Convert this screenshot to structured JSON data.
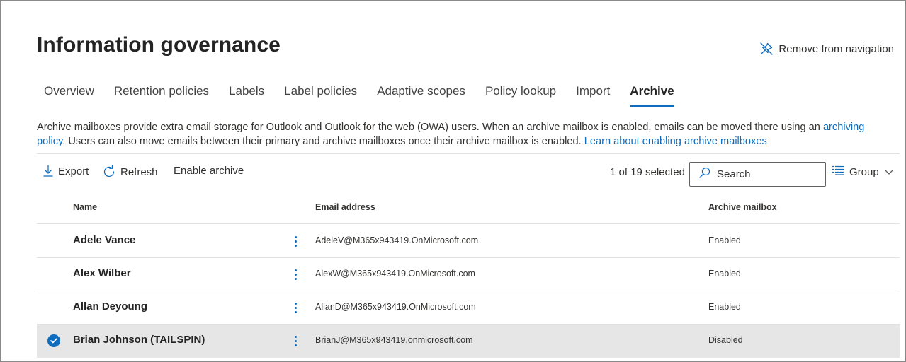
{
  "page": {
    "title": "Information governance",
    "remove_nav_label": "Remove from navigation"
  },
  "tabs": [
    {
      "label": "Overview",
      "active": false
    },
    {
      "label": "Retention policies",
      "active": false
    },
    {
      "label": "Labels",
      "active": false
    },
    {
      "label": "Label policies",
      "active": false
    },
    {
      "label": "Adaptive scopes",
      "active": false
    },
    {
      "label": "Policy lookup",
      "active": false
    },
    {
      "label": "Import",
      "active": false
    },
    {
      "label": "Archive",
      "active": true
    }
  ],
  "description": {
    "text1": "Archive mailboxes provide extra email storage for Outlook and Outlook for the web (OWA) users. When an archive mailbox is enabled, emails can be moved there using an ",
    "link1": "archiving policy",
    "text2": ". Users can also move emails between their primary and archive mailboxes once their archive mailbox is enabled. ",
    "link2": "Learn about enabling archive mailboxes"
  },
  "toolbar": {
    "export_label": "Export",
    "refresh_label": "Refresh",
    "enable_label": "Enable archive",
    "selected_count": "1 of 19 selected",
    "search_placeholder": "Search",
    "group_label": "Group"
  },
  "table": {
    "columns": [
      "Name",
      "Email address",
      "Archive mailbox"
    ],
    "rows": [
      {
        "name": "Adele Vance",
        "email": "AdeleV@M365x943419.OnMicrosoft.com",
        "status": "Enabled",
        "selected": false
      },
      {
        "name": "Alex Wilber",
        "email": "AlexW@M365x943419.OnMicrosoft.com",
        "status": "Enabled",
        "selected": false
      },
      {
        "name": "Allan Deyoung",
        "email": "AllanD@M365x943419.OnMicrosoft.com",
        "status": "Enabled",
        "selected": false
      },
      {
        "name": "Brian Johnson (TAILSPIN)",
        "email": "BrianJ@M365x943419.onmicrosoft.com",
        "status": "Disabled",
        "selected": true
      }
    ]
  },
  "icons": {
    "remove_nav": "unpin-icon",
    "export": "download-icon",
    "refresh": "refresh-icon",
    "search": "search-icon",
    "group": "list-icon",
    "group_chevron": "chevron-down-icon",
    "row_more": "more-vertical-icon",
    "row_selected": "checkmark-circle-icon"
  },
  "colors": {
    "accent": "#0f6cbd",
    "selected_row_bg": "#e6e6e6",
    "text": "#242424"
  }
}
